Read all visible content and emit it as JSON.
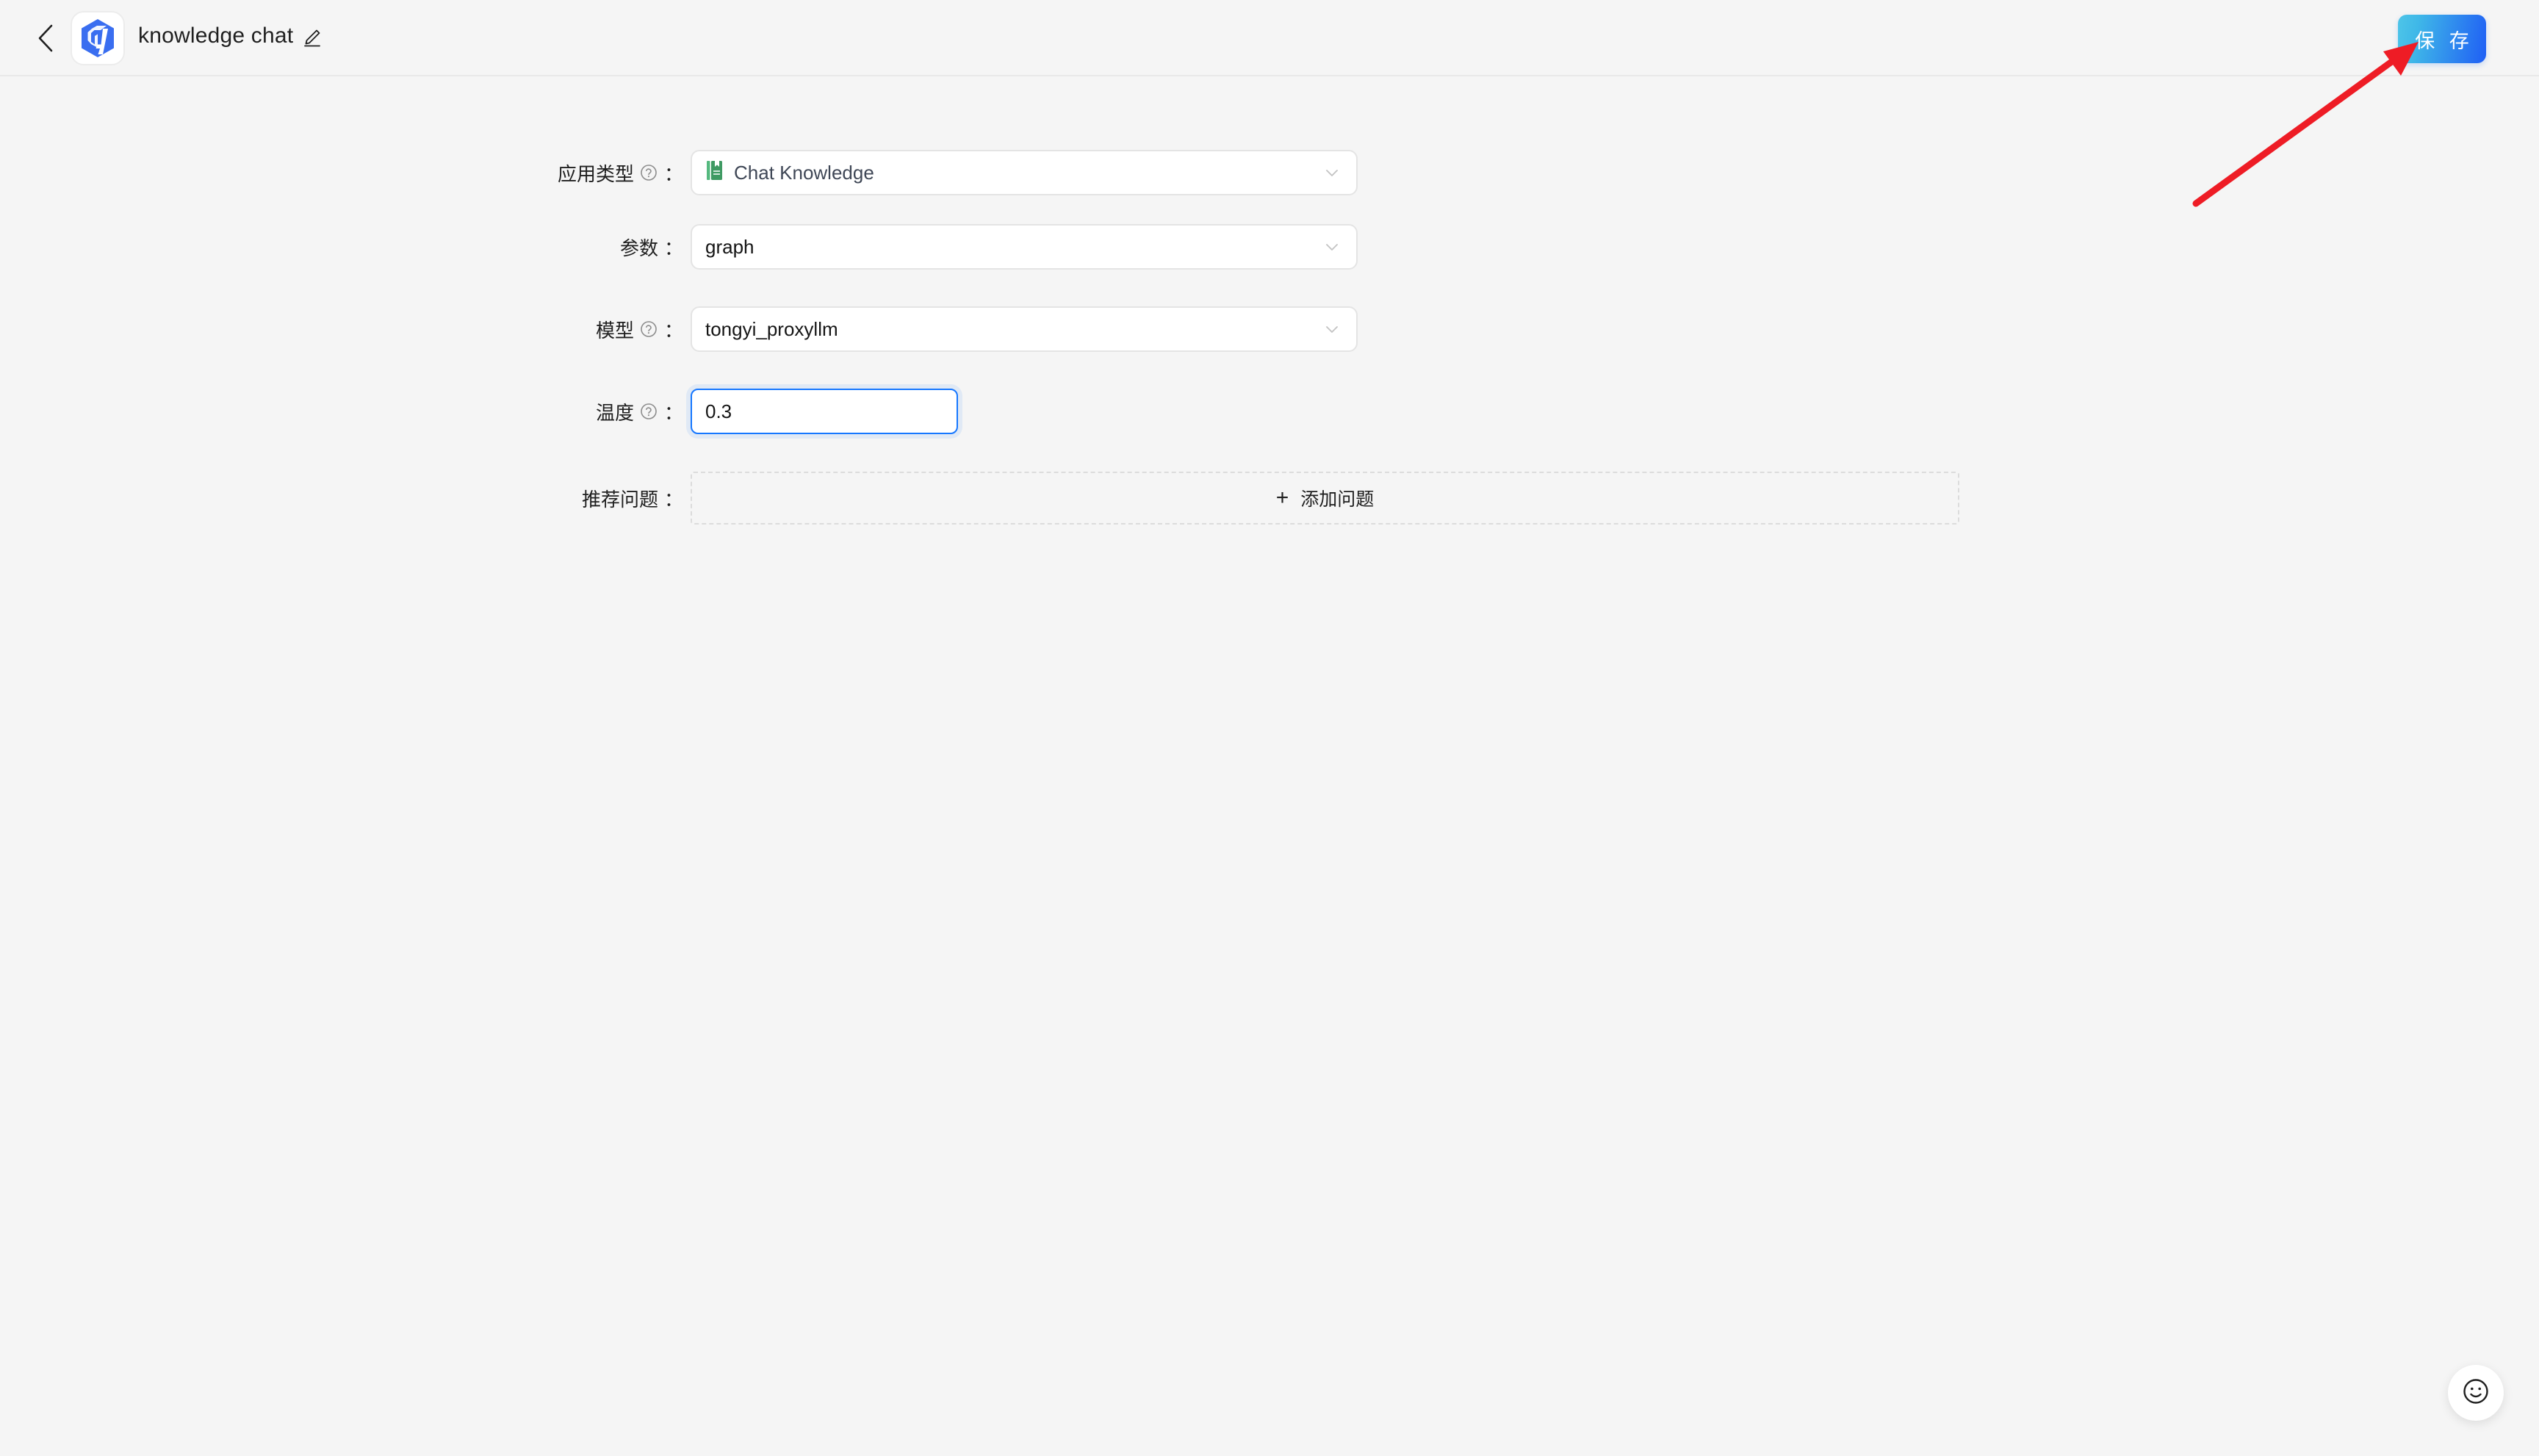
{
  "header": {
    "back_icon": "chevron-left-icon",
    "logo_icon": "app-logo-icon",
    "title": "knowledge chat",
    "edit_icon": "pencil-edit-icon",
    "save_label": "保 存",
    "save_gradient_from": "#4ec5e8",
    "save_gradient_to": "#1f5ff5"
  },
  "form": {
    "rows": [
      {
        "label": "应用类型",
        "help_icon": "question-circle-icon",
        "colon": "：",
        "control": "select",
        "value": "Chat Knowledge",
        "value_icon": "green-book-icon",
        "chevron_icon": "chevron-down-icon"
      },
      {
        "label": "参数",
        "help_icon": null,
        "colon": "：",
        "control": "select",
        "value": "graph",
        "chevron_icon": "chevron-down-icon"
      },
      {
        "label": "模型",
        "help_icon": "question-circle-icon",
        "colon": "：",
        "control": "select",
        "value": "tongyi_proxyllm",
        "chevron_icon": "chevron-down-icon"
      },
      {
        "label": "温度",
        "help_icon": "question-circle-icon",
        "colon": "：",
        "control": "input",
        "value": "0.3",
        "focused": true
      },
      {
        "label": "推荐问题",
        "help_icon": null,
        "colon": "：",
        "control": "dashed-add",
        "add_label": "添加问题",
        "add_icon": "plus-icon"
      }
    ]
  },
  "floating": {
    "feedback_icon": "smiley-face-icon"
  },
  "annotation": {
    "arrow_color": "#ee1c25"
  },
  "colors": {
    "page_background": "#f5f5f5",
    "accent_blue": "#1677ff",
    "book_green": "#4caf72",
    "logo_blue": "#3a6ef0"
  }
}
